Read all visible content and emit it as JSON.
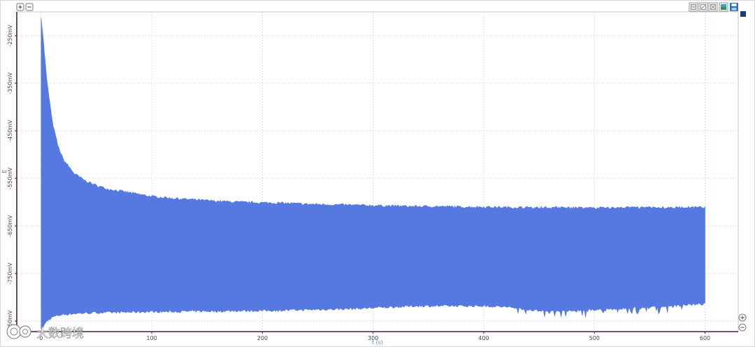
{
  "chart_data": {
    "type": "area",
    "title": "",
    "xlabel": "t (s)",
    "ylabel": "E",
    "xlim": [
      -22,
      630
    ],
    "ylim": [
      -872,
      -200
    ],
    "x_ticks": [
      0,
      100,
      200,
      300,
      400,
      500,
      600
    ],
    "x_tick_labels": [
      "0",
      "100",
      "200",
      "300",
      "400",
      "500",
      "600"
    ],
    "y_ticks": [
      -250,
      -350,
      -450,
      -550,
      -650,
      -750,
      -850
    ],
    "y_tick_labels": [
      "-250mV",
      "-350mV",
      "-450mV",
      "-550mV",
      "-650mV",
      "-750mV",
      "-850mV"
    ],
    "grid": true,
    "series": [
      {
        "color": "#5579e0",
        "x": [
          0,
          2,
          5,
          10,
          15,
          20,
          30,
          40,
          50,
          60,
          80,
          100,
          120,
          140,
          160,
          180,
          200,
          220,
          240,
          260,
          280,
          300,
          320,
          340,
          360,
          380,
          400,
          420,
          440,
          460,
          480,
          500,
          520,
          540,
          560,
          580,
          600
        ],
        "upper": [
          -210,
          -260,
          -340,
          -430,
          -480,
          -510,
          -540,
          -555,
          -565,
          -572,
          -580,
          -588,
          -592,
          -595,
          -598,
          -600,
          -601,
          -602,
          -604,
          -605,
          -606,
          -607,
          -608,
          -609,
          -609,
          -610,
          -610,
          -611,
          -611,
          -611,
          -612,
          -612,
          -612,
          -611,
          -611,
          -611,
          -611
        ],
        "lower": [
          -868,
          -862,
          -850,
          -842,
          -838,
          -836,
          -834,
          -833,
          -832,
          -832,
          -831,
          -830,
          -830,
          -829,
          -829,
          -828,
          -828,
          -827,
          -826,
          -825,
          -824,
          -822,
          -820,
          -818,
          -818,
          -818,
          -818,
          -820,
          -826,
          -830,
          -828,
          -826,
          -824,
          -822,
          -820,
          -816,
          -814
        ]
      }
    ]
  },
  "toolbar": {
    "zoom_in_icon": "zoom-in-icon",
    "zoom_out_icon": "zoom-out-icon",
    "export_icons": [
      "csv-icon",
      "xy-icon",
      "xml-icon",
      "image-icon",
      "save-icon"
    ]
  },
  "watermark": {
    "text": "大数跨境"
  }
}
